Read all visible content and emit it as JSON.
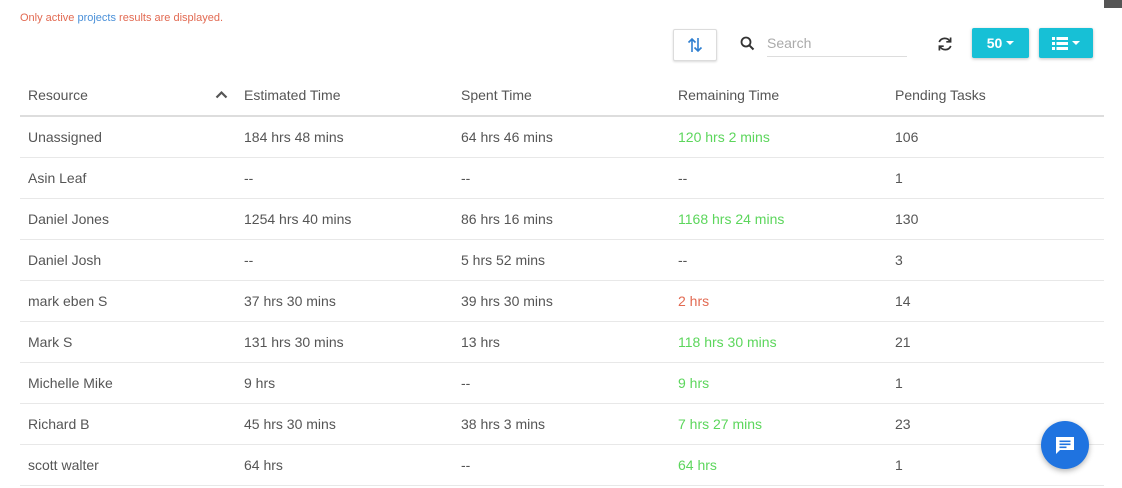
{
  "notice": {
    "prefix": "Only active ",
    "link": "projects",
    "suffix": " results are displayed."
  },
  "search": {
    "placeholder": "Search"
  },
  "toolbar": {
    "page_size": "50"
  },
  "table": {
    "headers": [
      "Resource",
      "Estimated Time",
      "Spent Time",
      "Remaining Time",
      "Pending Tasks"
    ],
    "rows": [
      {
        "resource": "Unassigned",
        "estimated": "184 hrs 48 mins",
        "spent": "64 hrs 46 mins",
        "remaining": "120 hrs 2 mins",
        "remaining_status": "green",
        "pending": "106"
      },
      {
        "resource": "Asin Leaf",
        "estimated": "--",
        "spent": "--",
        "remaining": "--",
        "remaining_status": "none",
        "pending": "1"
      },
      {
        "resource": "Daniel Jones",
        "estimated": "1254 hrs 40 mins",
        "spent": "86 hrs 16 mins",
        "remaining": "1168 hrs 24 mins",
        "remaining_status": "green",
        "pending": "130"
      },
      {
        "resource": "Daniel Josh",
        "estimated": "--",
        "spent": "5 hrs 52 mins",
        "remaining": "--",
        "remaining_status": "none",
        "pending": "3"
      },
      {
        "resource": "mark eben S",
        "estimated": "37 hrs 30 mins",
        "spent": "39 hrs 30 mins",
        "remaining": "2 hrs",
        "remaining_status": "red",
        "pending": "14"
      },
      {
        "resource": "Mark S",
        "estimated": "131 hrs 30 mins",
        "spent": "13 hrs",
        "remaining": "118 hrs 30 mins",
        "remaining_status": "green",
        "pending": "21"
      },
      {
        "resource": "Michelle Mike",
        "estimated": "9 hrs",
        "spent": "--",
        "remaining": "9 hrs",
        "remaining_status": "green",
        "pending": "1"
      },
      {
        "resource": "Richard B",
        "estimated": "45 hrs 30 mins",
        "spent": "38 hrs 3 mins",
        "remaining": "7 hrs 27 mins",
        "remaining_status": "green",
        "pending": "23"
      },
      {
        "resource": "scott walter",
        "estimated": "64 hrs",
        "spent": "--",
        "remaining": "64 hrs",
        "remaining_status": "green",
        "pending": "1"
      }
    ]
  },
  "colors": {
    "accent": "#17c0d6",
    "positive": "#5cd65c",
    "negative": "#e26a52",
    "link": "#4a90d9",
    "chat": "#1f73e0"
  },
  "icons": [
    "sort-toggle-icon",
    "search-icon",
    "refresh-icon",
    "columns-list-icon",
    "sort-asc-icon",
    "chat-icon"
  ]
}
